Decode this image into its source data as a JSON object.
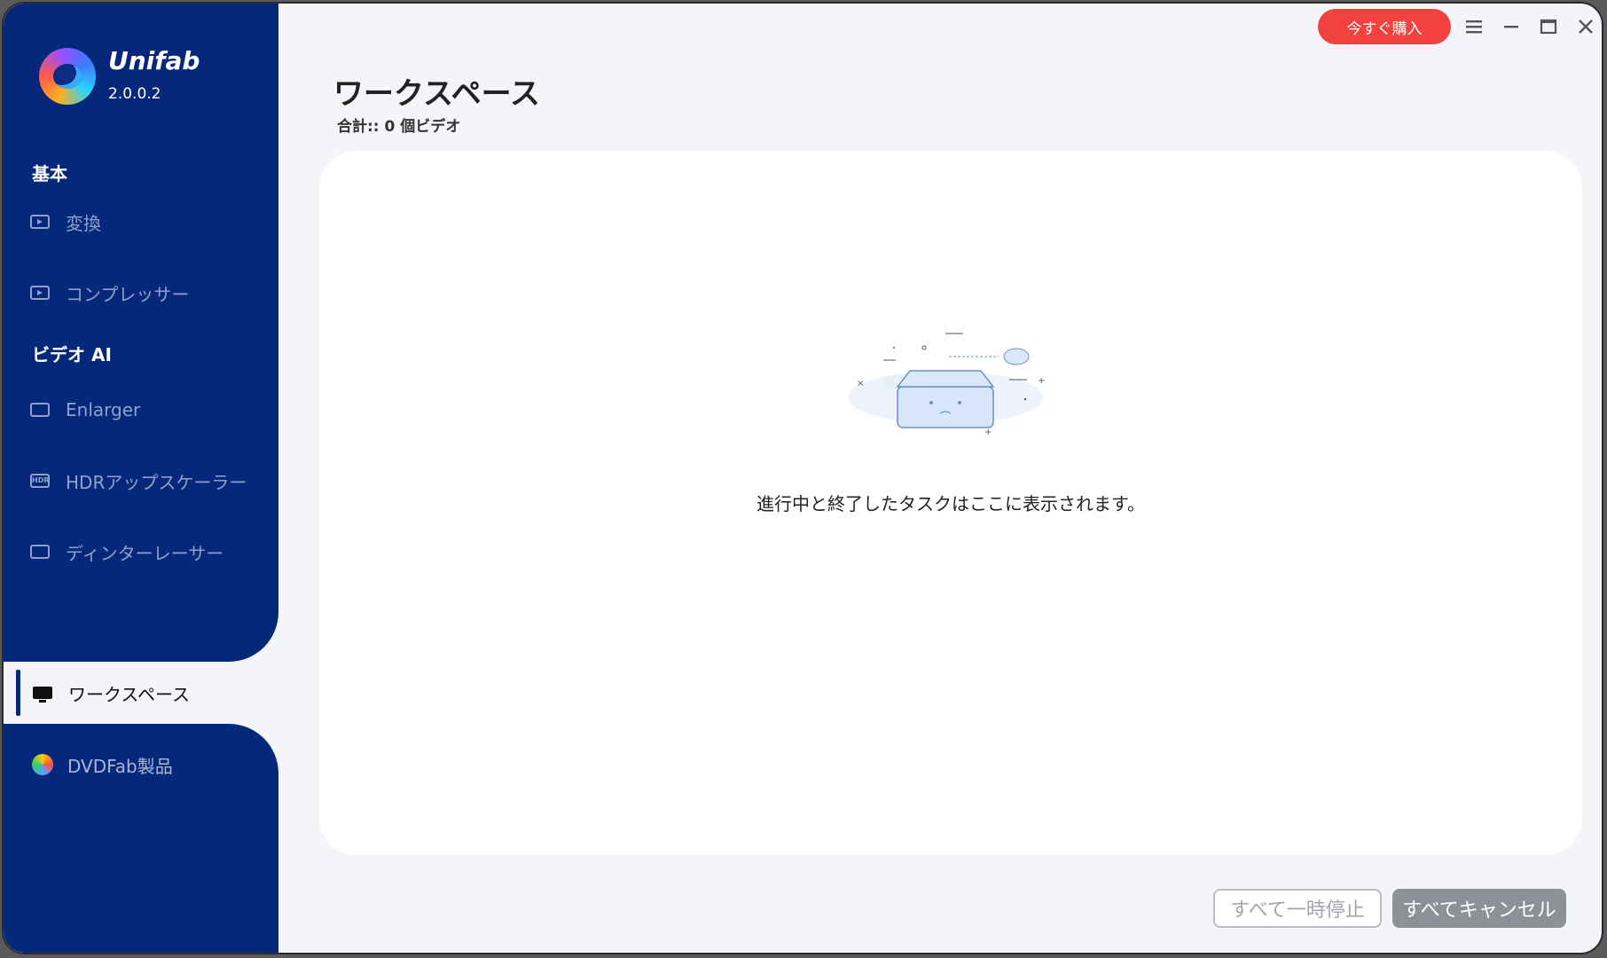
{
  "app": {
    "name": "Unifab",
    "version": "2.0.0.2"
  },
  "sidebar": {
    "section_basic": "基本",
    "convert_label": "変換",
    "compressor_label": "コンプレッサー",
    "section_ai": "ビデオ AI",
    "enlarger_label": "Enlarger",
    "hdr_label": "HDRアップスケーラー",
    "deinterlacer_label": "ディンターレーサー",
    "workspace_label": "ワークスペース",
    "dvdfab_label": "DVDFab製品"
  },
  "titlebar": {
    "buy_label": "今すぐ購入"
  },
  "main": {
    "title": "ワークスペース",
    "subtitle": "合計:: 0 個ビデオ",
    "empty_message": "進行中と終了したタスクはここに表示されます。"
  },
  "footer": {
    "pause_all_label": "すべて一時停止",
    "cancel_all_label": "すべてキャンセル"
  },
  "colors": {
    "sidebar_bg": "#06287a",
    "buy_button": "#f2423f",
    "main_bg": "#f3f5f9"
  }
}
